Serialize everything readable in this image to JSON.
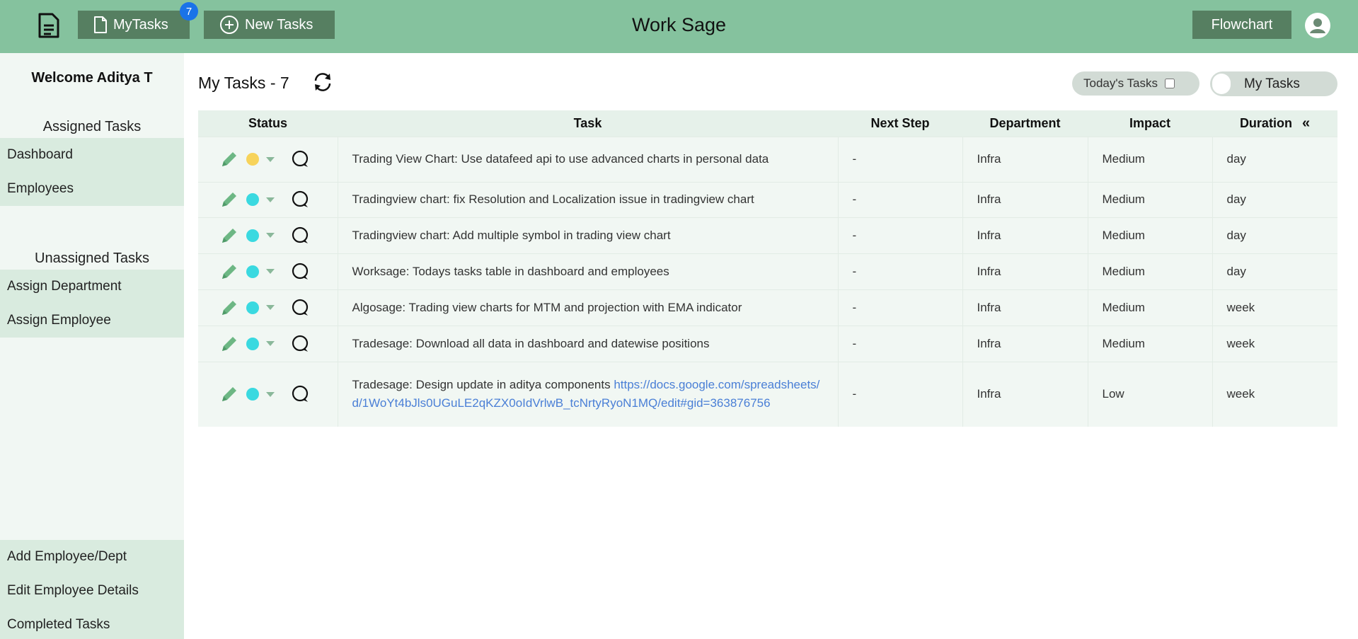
{
  "header": {
    "app_title": "Work Sage",
    "mytasks_label": "MyTasks",
    "mytasks_badge": "7",
    "newtasks_label": "New Tasks",
    "flowchart_label": "Flowchart"
  },
  "sidebar": {
    "welcome": "Welcome Aditya T",
    "assigned_title": "Assigned Tasks",
    "assigned_items": [
      "Dashboard",
      "Employees"
    ],
    "unassigned_title": "Unassigned Tasks",
    "unassigned_items": [
      "Assign Department",
      "Assign Employee"
    ],
    "bottom_items": [
      "Add Employee/Dept",
      "Edit Employee Details",
      "Completed Tasks"
    ]
  },
  "main": {
    "title": "My Tasks - 7",
    "todays_tasks_label": "Today's Tasks",
    "my_tasks_switch_label": "My Tasks"
  },
  "table": {
    "columns": [
      "Status",
      "Task",
      "Next Step",
      "Department",
      "Impact",
      "Duration"
    ],
    "rows": [
      {
        "status_color": "#f7d35a",
        "task": "Trading View Chart: Use datafeed api to use advanced charts in personal data",
        "link": "",
        "next_step": "-",
        "department": "Infra",
        "impact": "Medium",
        "duration": "day"
      },
      {
        "status_color": "#3ad9e0",
        "task": "Tradingview chart: fix Resolution and Localization issue in tradingview chart",
        "link": "",
        "next_step": "-",
        "department": "Infra",
        "impact": "Medium",
        "duration": "day"
      },
      {
        "status_color": "#3ad9e0",
        "task": "Tradingview chart: Add multiple symbol in trading view chart",
        "link": "",
        "next_step": "-",
        "department": "Infra",
        "impact": "Medium",
        "duration": "day"
      },
      {
        "status_color": "#3ad9e0",
        "task": "Worksage: Todays tasks table in dashboard and employees",
        "link": "",
        "next_step": "-",
        "department": "Infra",
        "impact": "Medium",
        "duration": "day"
      },
      {
        "status_color": "#3ad9e0",
        "task": "Algosage: Trading view charts for MTM and projection with EMA indicator",
        "link": "",
        "next_step": "-",
        "department": "Infra",
        "impact": "Medium",
        "duration": "week"
      },
      {
        "status_color": "#3ad9e0",
        "task": "Tradesage: Download all data in dashboard and datewise positions",
        "link": "",
        "next_step": "-",
        "department": "Infra",
        "impact": "Medium",
        "duration": "week"
      },
      {
        "status_color": "#3ad9e0",
        "task": "Tradesage: Design update in aditya components ",
        "link": "https://docs.google.com/spreadsheets/d/1WoYt4bJls0UGuLE2qKZX0oIdVrlwB_tcNrtyRyoN1MQ/edit#gid=363876756",
        "next_step": "-",
        "department": "Infra",
        "impact": "Low",
        "duration": "week"
      }
    ]
  },
  "colors": {
    "header_bg": "#85c29e",
    "button_bg": "#567f61",
    "sidebar_bg": "#f1f7f3",
    "nav_bg": "#d9ebdf",
    "pencil": "#6db784",
    "badge": "#1a73e8",
    "link": "#4a7fd6"
  }
}
